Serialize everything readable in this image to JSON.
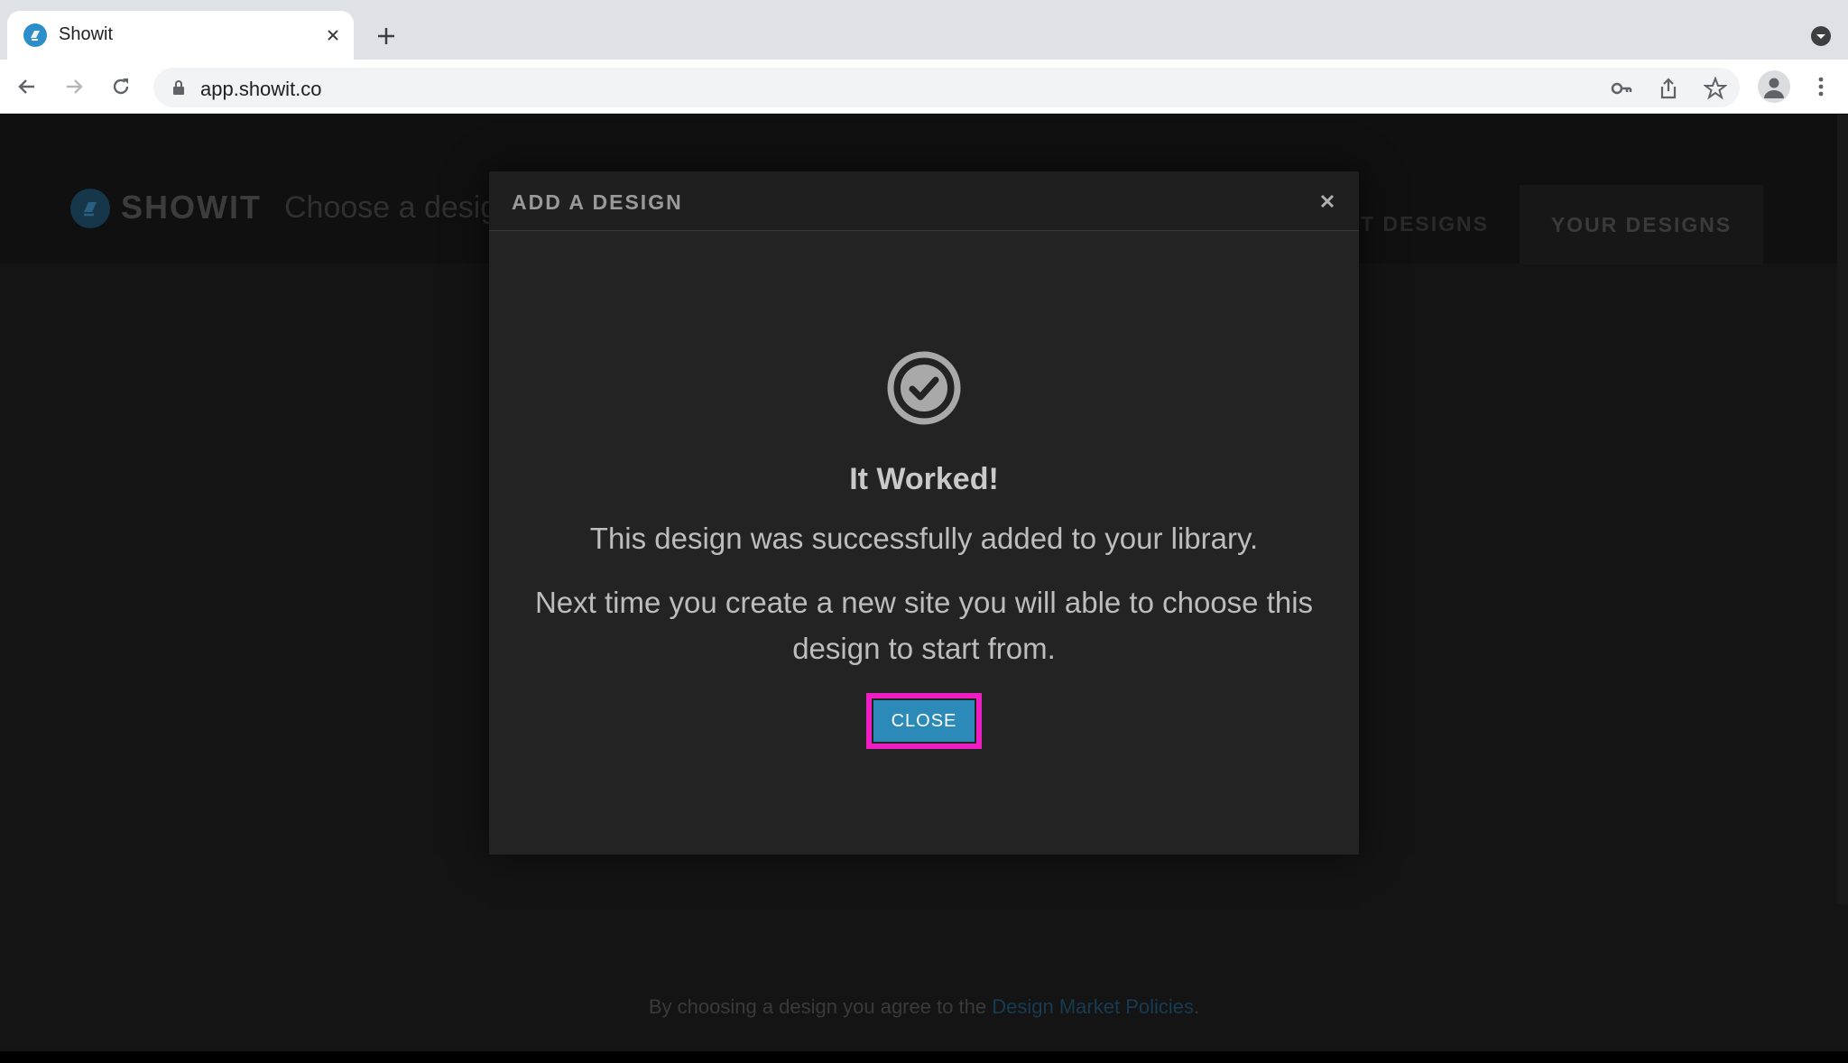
{
  "browser": {
    "tab_title": "Showit",
    "url": "app.showit.co"
  },
  "page": {
    "logo_text": "SHOWIT",
    "subtitle": "Choose a design",
    "tab_left": "MARKET DESIGNS",
    "tab_right": "YOUR DESIGNS",
    "footer_prefix": "By choosing a design you agree to the ",
    "footer_link": "Design Market Policies",
    "footer_suffix": "."
  },
  "modal": {
    "title": "ADD A DESIGN",
    "heading": "It Worked!",
    "line1": "This design was successfully added to your library.",
    "line2": "Next time you create a new site you will able to choose this design to start from.",
    "close_label": "CLOSE"
  },
  "colors": {
    "accent": "#2b8ab8",
    "highlight": "#ee1fc2"
  },
  "icons": {
    "favicon": "showit-logo-icon",
    "tab_close": "close-icon",
    "new_tab": "plus-icon",
    "back": "arrow-left-icon",
    "forward": "arrow-right-icon",
    "reload": "reload-icon",
    "lock": "lock-icon",
    "key": "key-icon",
    "share": "share-icon",
    "bookmark": "star-icon",
    "profile": "avatar-icon",
    "menu": "kebab-menu-icon",
    "success": "check-circle-icon"
  }
}
